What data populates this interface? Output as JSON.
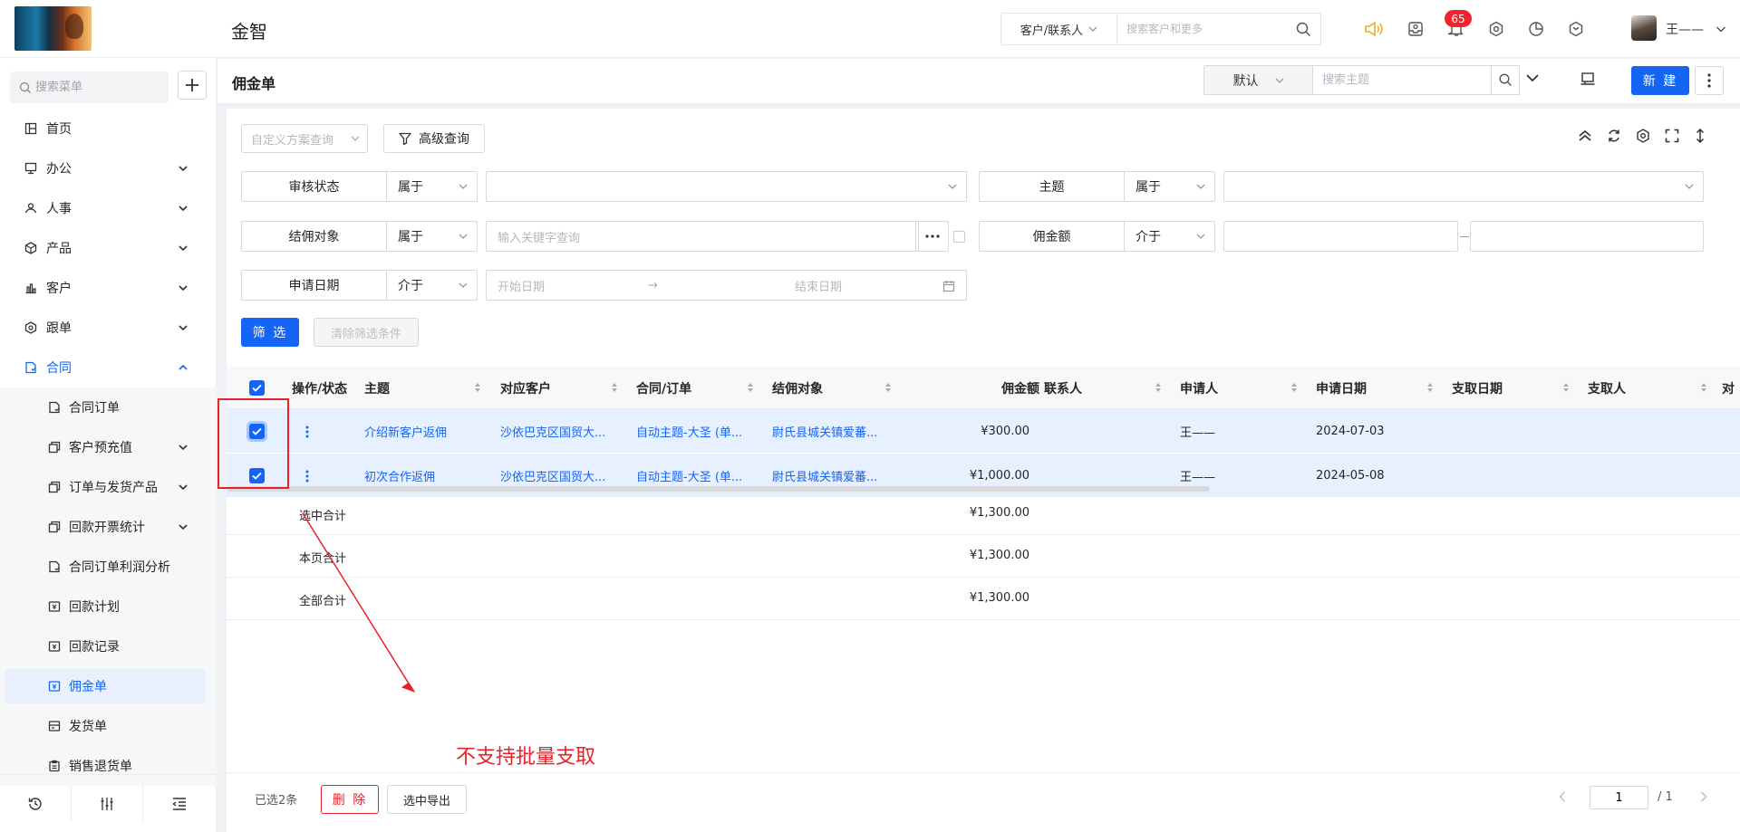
{
  "app": {
    "name": "金智"
  },
  "topbar": {
    "search_scope": "客户/联系人",
    "search_placeholder": "搜索客户和更多",
    "notification_count": "65",
    "user_name": "王——",
    "icons": [
      "speaker-icon",
      "inbox-icon",
      "bell-icon",
      "gear-icon",
      "chart-pie-icon",
      "cube-icon"
    ]
  },
  "sidebar": {
    "search_placeholder": "搜索菜单",
    "items": [
      {
        "label": "首页",
        "icon": "home-icon"
      },
      {
        "label": "办公",
        "icon": "office-icon"
      },
      {
        "label": "人事",
        "icon": "people-icon"
      },
      {
        "label": "产品",
        "icon": "product-icon"
      },
      {
        "label": "客户",
        "icon": "customer-icon"
      },
      {
        "label": "跟单",
        "icon": "follow-icon"
      },
      {
        "label": "合同",
        "icon": "contract-icon"
      }
    ],
    "sub_items": [
      {
        "label": "合同订单"
      },
      {
        "label": "客户预充值"
      },
      {
        "label": "订单与发货产品"
      },
      {
        "label": "回款开票统计"
      },
      {
        "label": "合同订单利润分析"
      },
      {
        "label": "回款计划"
      },
      {
        "label": "回款记录"
      },
      {
        "label": "佣金单"
      },
      {
        "label": "发货单"
      },
      {
        "label": "销售退货单"
      }
    ]
  },
  "page": {
    "title": "佣金单",
    "view": "默认",
    "subject_placeholder": "搜索主题",
    "new_label": "新 建"
  },
  "filters": {
    "custom_query_placeholder": "自定义方案查询",
    "advanced_label": "高级查询",
    "rows": [
      {
        "name": "审核状态",
        "op": "属于"
      },
      {
        "name": "主题",
        "op": "属于"
      },
      {
        "name": "结佣对象",
        "op": "属于",
        "placeholder": "输入关键字查询"
      },
      {
        "name": "佣金额",
        "op": "介于"
      },
      {
        "name": "申请日期",
        "op": "介于",
        "start_placeholder": "开始日期",
        "end_placeholder": "结束日期"
      }
    ],
    "filter_label": "筛 选",
    "clear_label": "清除筛选条件"
  },
  "table": {
    "columns": [
      "操作/状态",
      "主题",
      "对应客户",
      "合同/订单",
      "结佣对象",
      "佣金额",
      "联系人",
      "申请人",
      "申请日期",
      "支取日期",
      "支取人",
      "对"
    ],
    "rows": [
      {
        "subject": "介绍新客户返佣",
        "customer": "沙依巴克区国贸大...",
        "contract": "自动主题-大圣 (单...",
        "target": "尉氏县城关镇爱蕃...",
        "amount": "¥300.00",
        "contact": "",
        "applicant": "王——",
        "date": "2024-07-03"
      },
      {
        "subject": "初次合作返佣",
        "customer": "沙依巴克区国贸大...",
        "contract": "自动主题-大圣 (单...",
        "target": "尉氏县城关镇爱蕃...",
        "amount": "¥1,000.00",
        "contact": "",
        "applicant": "王——",
        "date": "2024-05-08"
      }
    ],
    "summaries": [
      {
        "label": "选中合计",
        "value": "¥1,300.00"
      },
      {
        "label": "本页合计",
        "value": "¥1,300.00"
      },
      {
        "label": "全部合计",
        "value": "¥1,300.00"
      }
    ]
  },
  "annotation": {
    "text": "不支持批量支取",
    "color": "#e8202a"
  },
  "footer": {
    "selected": "已选2条",
    "delete_label": "删 除",
    "export_label": "选中导出",
    "page": "1",
    "total": "/ 1"
  },
  "colors": {
    "accent": "#1465f5",
    "selected_row": "#e6f0fe",
    "danger": "#e8202a"
  }
}
